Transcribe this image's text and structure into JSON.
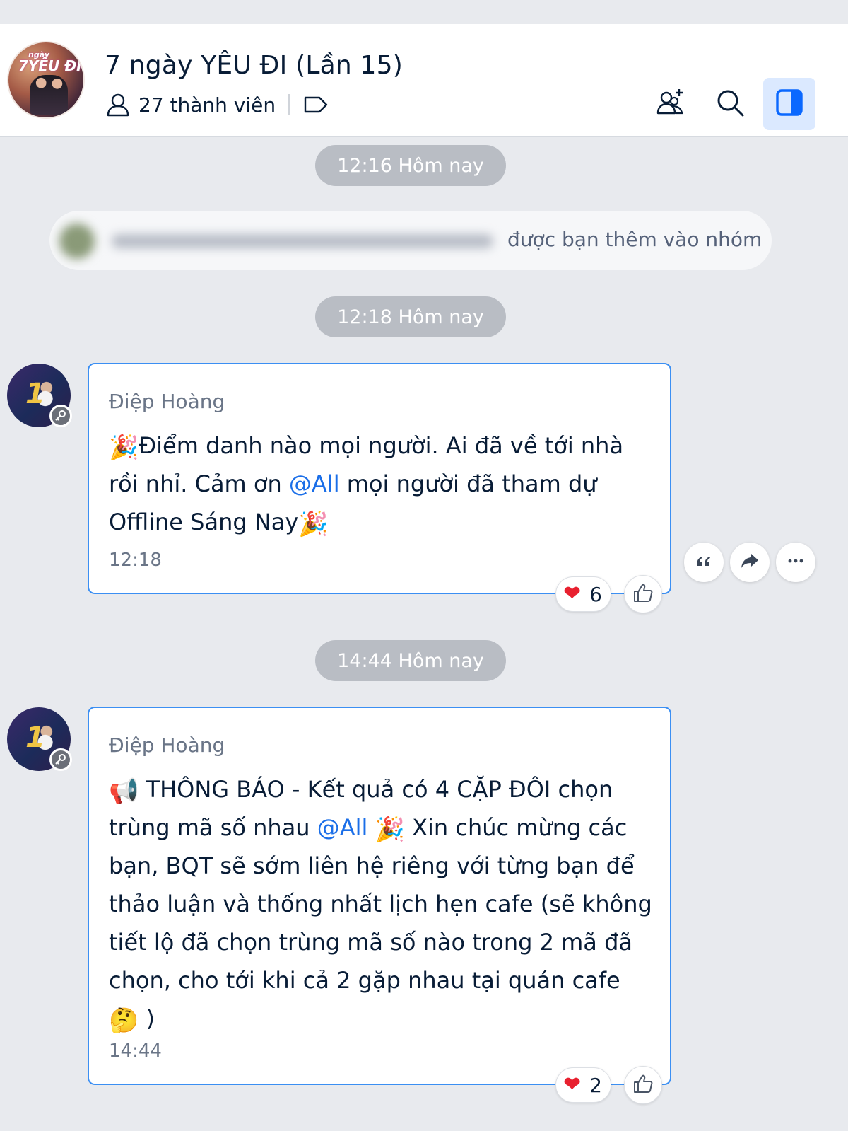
{
  "header": {
    "title": "7 ngày YÊU ĐI (Lần 15)",
    "member_count": "27 thành viên",
    "avatar_text_top": "ngày",
    "avatar_text_main": "7YÊU ĐI",
    "icons": [
      "user-icon",
      "tag-icon",
      "add-member-icon",
      "search-icon",
      "side-panel-icon"
    ]
  },
  "timestamps": {
    "t1": "12:16 Hôm nay",
    "t2": "12:18 Hôm nay",
    "t3": "14:44 Hôm nay"
  },
  "system_message": {
    "text": "được bạn thêm vào nhóm"
  },
  "messages": [
    {
      "sender": "Điệp Hoàng",
      "parts": {
        "p1": "Điểm danh nào mọi người. Ai đã về tới nhà rồi nhỉ. Cảm ơn ",
        "mention": "@All",
        "p2": " mọi người đã tham dự Offline Sáng Nay"
      },
      "time": "12:18",
      "reaction_emoji": "❤",
      "reaction_count": "6"
    },
    {
      "sender": "Điệp Hoàng",
      "parts": {
        "p1": " THÔNG BÁO - Kết quả có 4 CẶP ĐÔI chọn trùng mã số nhau ",
        "mention": "@All",
        "p2": " Xin chúc mừng các bạn, BQT sẽ sớm liên hệ riêng với từng bạn để thảo luận và thống nhất lịch hẹn cafe (sẽ không tiết lộ đã chọn trùng mã số nào trong 2 mã đã chọn, cho tới khi cả 2 gặp nhau tại quán cafe ",
        "p3": ")"
      },
      "time": "14:44",
      "reaction_emoji": "❤",
      "reaction_count": "2"
    }
  ],
  "emoji": {
    "party": "🎉",
    "megaphone": "📢",
    "thinking": "🤔"
  },
  "colors": {
    "accent": "#1a6ee8",
    "bubble_border": "#3b8ff3",
    "background": "#e8eaee",
    "time_pill": "#b9bdc4"
  }
}
